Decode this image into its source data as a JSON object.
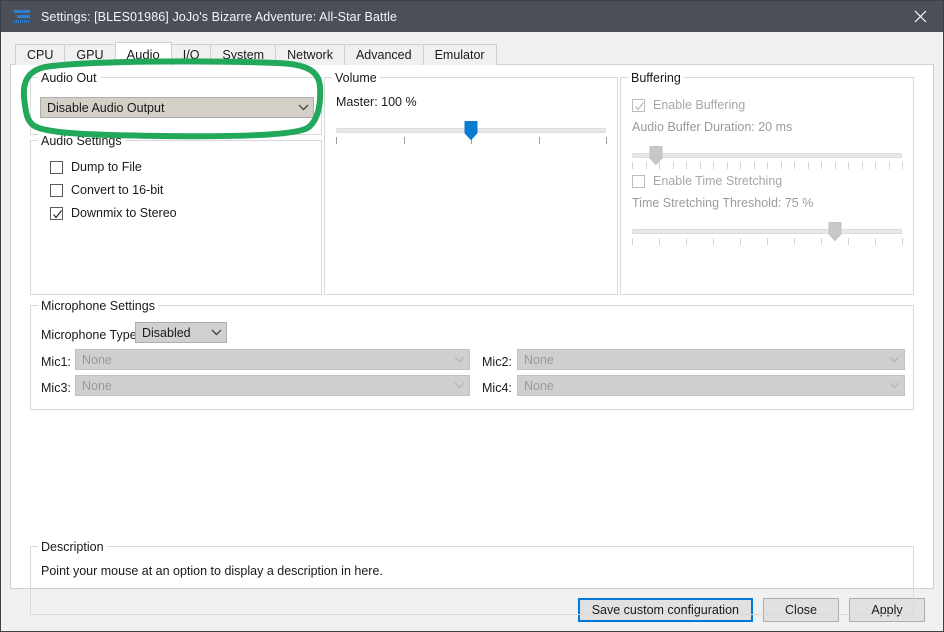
{
  "window": {
    "title": "Settings: [BLES01986] JoJo's Bizarre Adventure: All-Star Battle",
    "app_icon": "rpcs3-logo-icon",
    "close_label": "✕"
  },
  "tabs": [
    {
      "label": "CPU",
      "active": false
    },
    {
      "label": "GPU",
      "active": false
    },
    {
      "label": "Audio",
      "active": true
    },
    {
      "label": "I/O",
      "active": false
    },
    {
      "label": "System",
      "active": false
    },
    {
      "label": "Network",
      "active": false
    },
    {
      "label": "Advanced",
      "active": false
    },
    {
      "label": "Emulator",
      "active": false
    }
  ],
  "audio_out": {
    "legend": "Audio Out",
    "selected": "Disable Audio Output"
  },
  "audio_settings": {
    "legend": "Audio Settings",
    "checkboxes": [
      {
        "label": "Dump to File",
        "checked": false,
        "enabled": true
      },
      {
        "label": "Convert to 16-bit",
        "checked": false,
        "enabled": true
      },
      {
        "label": "Downmix to Stereo",
        "checked": true,
        "enabled": true
      }
    ]
  },
  "volume": {
    "legend": "Volume",
    "master_label": "Master: 100 %",
    "master_value": 100,
    "master_min": 0,
    "master_max": 200,
    "tick_count": 5,
    "handle_color": "#0a7cd0"
  },
  "buffering": {
    "legend": "Buffering",
    "enable_buffering": {
      "label": "Enable Buffering",
      "checked": true,
      "enabled": false
    },
    "buffer_duration_label": "Audio Buffer Duration: 20 ms",
    "buffer_duration_value": 20,
    "buffer_duration_min": 4,
    "buffer_duration_max": 250,
    "buffer_tick_count": 21,
    "enable_time_stretching": {
      "label": "Enable Time Stretching",
      "checked": false,
      "enabled": false
    },
    "time_stretch_label": "Time Stretching Threshold: 75 %",
    "time_stretch_value": 75,
    "time_stretch_min": 0,
    "time_stretch_max": 100,
    "time_stretch_tick_count": 11,
    "handle_color": "#c8c8c8"
  },
  "microphone": {
    "legend": "Microphone Settings",
    "type_label": "Microphone Type:",
    "type_selected": "Disabled",
    "mics": [
      {
        "label": "Mic1:",
        "value": "None",
        "enabled": false
      },
      {
        "label": "Mic2:",
        "value": "None",
        "enabled": false
      },
      {
        "label": "Mic3:",
        "value": "None",
        "enabled": false
      },
      {
        "label": "Mic4:",
        "value": "None",
        "enabled": false
      }
    ]
  },
  "description": {
    "legend": "Description",
    "text": "Point your mouse at an option to display a description in here."
  },
  "buttons": {
    "save": "Save custom configuration",
    "close": "Close",
    "apply": "Apply"
  },
  "annotation": {
    "shape": "green-ellipse-highlight",
    "color": "#22a85a",
    "target": "Audio Out"
  }
}
